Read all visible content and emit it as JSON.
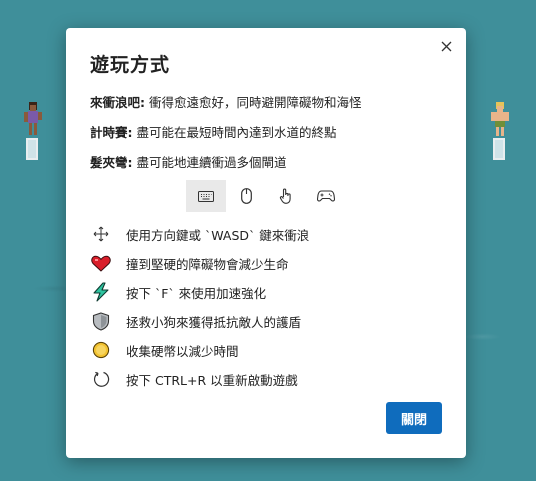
{
  "dialog": {
    "title": "遊玩方式",
    "modes": [
      {
        "name": "來衝浪吧:",
        "text": " 衝得愈遠愈好，同時避開障礙物和海怪"
      },
      {
        "name": "計時賽:",
        "text": " 盡可能在最短時間內達到水道的終點"
      },
      {
        "name": "髮夾彎:",
        "text": " 盡可能地連續衝過多個閘道"
      }
    ],
    "input_tabs": [
      {
        "icon": "keyboard-icon",
        "selected": true
      },
      {
        "icon": "mouse-icon",
        "selected": false
      },
      {
        "icon": "touch-icon",
        "selected": false
      },
      {
        "icon": "gamepad-icon",
        "selected": false
      }
    ],
    "instructions": [
      {
        "icon": "move-arrows-icon",
        "text": "使用方向鍵或 `WASD` 鍵來衝浪"
      },
      {
        "icon": "heart-icon",
        "text": "撞到堅硬的障礙物會減少生命"
      },
      {
        "icon": "lightning-icon",
        "text": "按下 `F` 來使用加速強化"
      },
      {
        "icon": "shield-icon",
        "text": "拯救小狗來獲得抵抗敵人的護盾"
      },
      {
        "icon": "coin-icon",
        "text": "收集硬幣以減少時間"
      },
      {
        "icon": "restart-icon",
        "text": "按下 CTRL+R 以重新啟動遊戲"
      }
    ],
    "close_label": "關閉"
  },
  "colors": {
    "water": "#3f8f9a",
    "accent": "#0f6cbd",
    "heart": "#d91e2a",
    "lightning": "#2ec4a0",
    "coin": "#f2c230"
  }
}
